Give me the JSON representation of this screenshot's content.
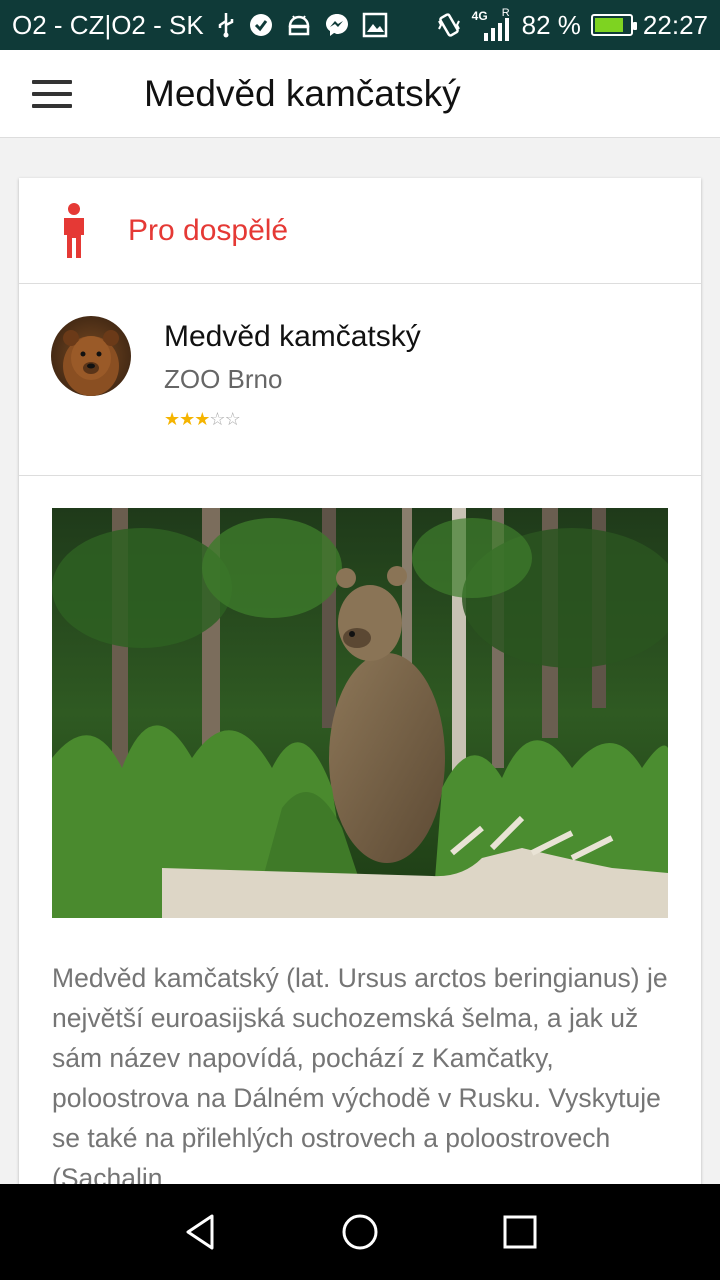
{
  "status_bar": {
    "carrier": "O2 - CZ|O2 - SK",
    "network": "4G",
    "roaming": "R",
    "battery_percent": "82 %",
    "battery_level": 0.82,
    "time": "22:27",
    "icons": [
      "usb-icon",
      "check-badge-icon",
      "android-icon",
      "messenger-icon",
      "image-icon",
      "vibrate-icon",
      "signal-icon",
      "battery-charging-icon"
    ]
  },
  "app_bar": {
    "title": "Medvěd kamčatský",
    "menu_icon": "hamburger-menu-icon"
  },
  "card": {
    "category": {
      "label": "Pro dospělé",
      "icon": "person-icon",
      "color": "#e53935"
    },
    "animal": {
      "name": "Medvěd kamčatský",
      "zoo": "ZOO Brno",
      "rating": 3,
      "rating_max": 5,
      "rating_color": "#f5b400"
    },
    "description": "Medvěd kamčatský (lat. Ursus arctos beringianus) je největší euroasijská suchozemská šelma, a jak už sám název napovídá, pochází z Kamčatky, poloostrova na Dálném východě v Rusku. Vyskytuje se také na přilehlých ostrovech a poloostrovech (Sachalin"
  },
  "nav_bar": {
    "buttons": [
      "back-icon",
      "home-icon",
      "recents-icon"
    ]
  },
  "colors": {
    "status_bar": "#0f3a38",
    "accent": "#e53935"
  }
}
